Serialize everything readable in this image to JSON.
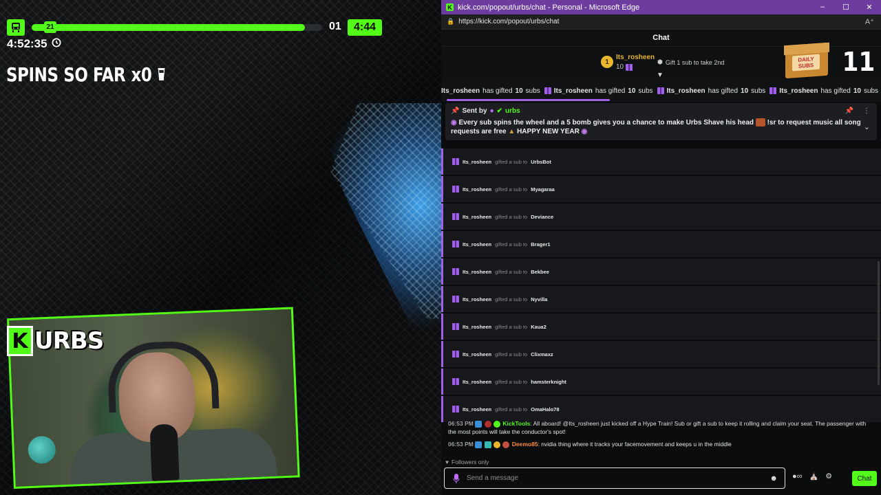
{
  "stream": {
    "hype_level": "21",
    "hype_progress": 0.94,
    "hype_number": "01",
    "hype_timer": "4:44",
    "clock": "4:52:35",
    "spins_text": "SPINS SO FAR",
    "spins_value": "x0",
    "logo_text": "URBS",
    "logo_k": "K"
  },
  "window": {
    "title": "kick.com/popout/urbs/chat - Personal - Microsoft Edge",
    "url": "https://kick.com/popout/urbs/chat",
    "controls": [
      "–",
      "☐",
      "✕"
    ]
  },
  "chat": {
    "header": "Chat",
    "leader": {
      "rank": "1",
      "name": "Its_rosheen",
      "count": "10",
      "gift_cta": "Gift 1 sub to take 2nd"
    },
    "daily_subs": {
      "label_1": "DAILY",
      "label_2": "SUBS",
      "count": "11"
    },
    "ticker": [
      {
        "prefix": "Its_rosheen",
        "mid": "has gifted",
        "num": "10",
        "suffix": "subs"
      },
      {
        "prefix": "Its_rosheen",
        "mid": "has gifted",
        "num": "10",
        "suffix": "subs"
      },
      {
        "prefix": "Its_rosheen",
        "mid": "has gifted",
        "num": "10",
        "suffix": "subs"
      },
      {
        "prefix": "Its_rosheen",
        "mid": "has gifted",
        "num": "10",
        "suffix": "subs"
      }
    ],
    "pinned": {
      "sent_by": "Sent by",
      "user": "urbs",
      "message_a": "Every sub spins the wheel and a 5 bomb gives you a chance to make Urbs Shave his head",
      "message_b": "!sr to request music all song requests are free",
      "message_c": "HAPPY NEW YEAR"
    },
    "gifts": [
      {
        "from": "Its_rosheen",
        "verb": "gifted a sub to",
        "to": "UrbsBot"
      },
      {
        "from": "Its_rosheen",
        "verb": "gifted a sub to",
        "to": "Myagaraa"
      },
      {
        "from": "Its_rosheen",
        "verb": "gifted a sub to",
        "to": "Deviance"
      },
      {
        "from": "Its_rosheen",
        "verb": "gifted a sub to",
        "to": "Brager1"
      },
      {
        "from": "Its_rosheen",
        "verb": "gifted a sub to",
        "to": "Bekbee"
      },
      {
        "from": "Its_rosheen",
        "verb": "gifted a sub to",
        "to": "Nyvilla"
      },
      {
        "from": "Its_rosheen",
        "verb": "gifted a sub to",
        "to": "Kaua2"
      },
      {
        "from": "Its_rosheen",
        "verb": "gifted a sub to",
        "to": "Clixmaxz"
      },
      {
        "from": "Its_rosheen",
        "verb": "gifted a sub to",
        "to": "hamsterknight"
      },
      {
        "from": "Its_rosheen",
        "verb": "gifted a sub to",
        "to": "OmaHalo78"
      }
    ],
    "messages": [
      {
        "time": "06:53 PM",
        "user": "KickTools",
        "text": "All aboard! @Its_rosheen just kicked off a Hype Train! Sub or gift a sub to keep it rolling and claim your seat. The passenger with the most points will take the conductor's spot!"
      },
      {
        "time": "06:53 PM",
        "user": "Deemo85",
        "text": "nvidia thing where it tracks your facemovement and keeps u in the middle"
      }
    ],
    "followers_only": "Followers only",
    "composer_placeholder": "Send a message",
    "send_label": "Chat"
  },
  "colors": {
    "accent": "#53fc18",
    "purple": "#a061e8",
    "titlebar": "#6c3d9e",
    "gold": "#e8b72c"
  }
}
